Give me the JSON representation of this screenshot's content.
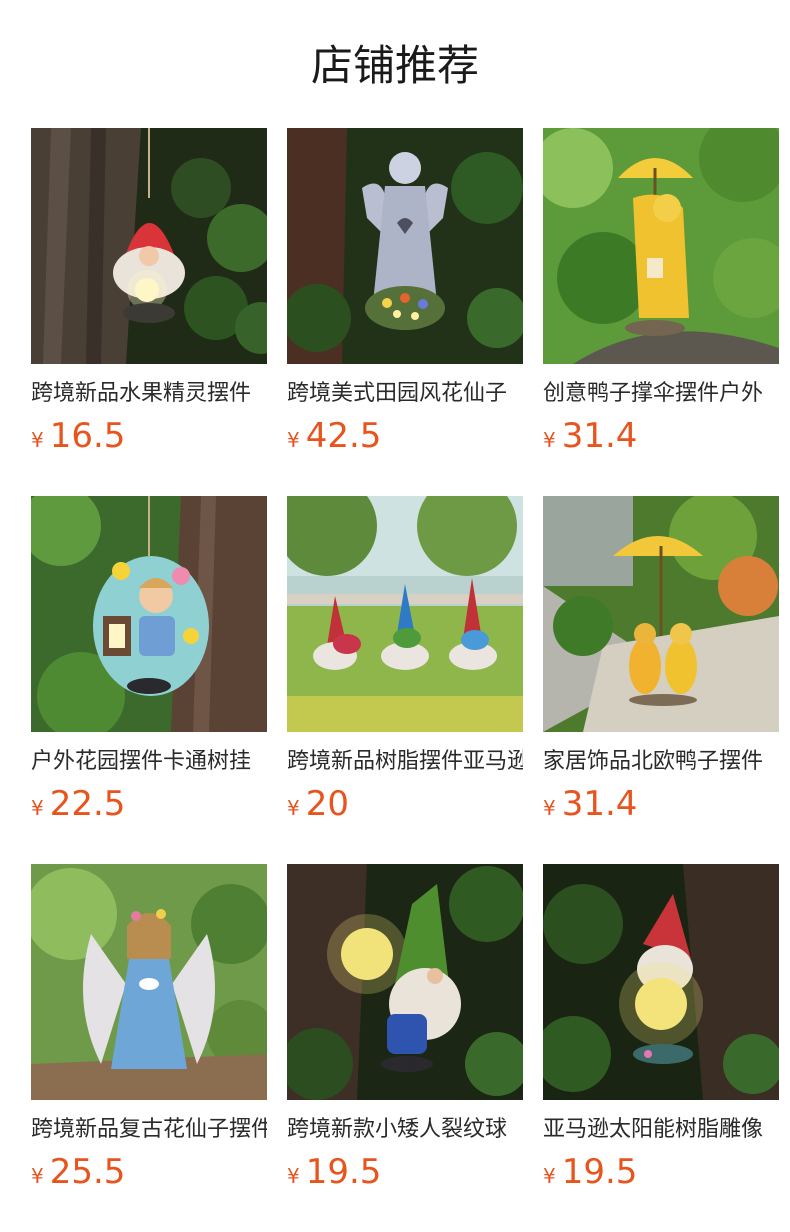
{
  "header": {
    "title": "店铺推荐"
  },
  "colors": {
    "price": "#e8541e",
    "title": "#1a1a1a"
  },
  "products": [
    {
      "name": "跨境新品水果精灵摆件",
      "currency": "¥",
      "price": "16.5",
      "image": "gnome-lantern-hanging"
    },
    {
      "name": "跨境美式田园风花仙子",
      "currency": "¥",
      "price": "42.5",
      "image": "angel-statue-flowers"
    },
    {
      "name": "创意鸭子撑伞摆件户外",
      "currency": "¥",
      "price": "31.4",
      "image": "duck-umbrella-yellow"
    },
    {
      "name": "户外花园摆件卡通树挂",
      "currency": "¥",
      "price": "22.5",
      "image": "girl-lantern-tree"
    },
    {
      "name": "跨境新品树脂摆件亚马逊",
      "currency": "¥",
      "price": "20",
      "image": "three-gnomes-lawn"
    },
    {
      "name": "家居饰品北欧鸭子摆件",
      "currency": "¥",
      "price": "31.4",
      "image": "two-ducks-umbrella"
    },
    {
      "name": "跨境新品复古花仙子摆件",
      "currency": "¥",
      "price": "25.5",
      "image": "fairy-blue-dress"
    },
    {
      "name": "跨境新款小矮人裂纹球",
      "currency": "¥",
      "price": "19.5",
      "image": "gnome-glowing-ball"
    },
    {
      "name": "亚马逊太阳能树脂雕像",
      "currency": "¥",
      "price": "19.5",
      "image": "gnome-solar-ball"
    }
  ]
}
